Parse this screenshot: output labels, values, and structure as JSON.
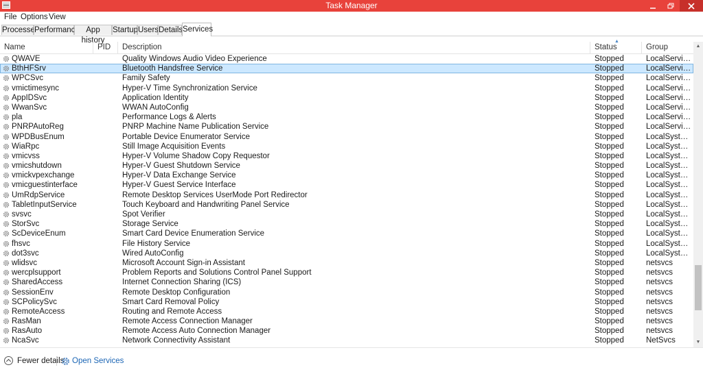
{
  "window": {
    "title": "Task Manager",
    "icon": "task-manager-icon",
    "controls": [
      "minimize-icon",
      "maximize-icon",
      "close-icon"
    ]
  },
  "menu": {
    "file": "File",
    "options": "Options",
    "view": "View"
  },
  "tabs": [
    "Processes",
    "Performance",
    "App history",
    "Startup",
    "Users",
    "Details",
    "Services"
  ],
  "active_tab": "Services",
  "columns": {
    "name": "Name",
    "pid": "PID",
    "description": "Description",
    "status": "Status",
    "group": "Group"
  },
  "sort": {
    "column": "Status",
    "direction": "ascending"
  },
  "services": [
    {
      "name": "QWAVE",
      "pid": "",
      "description": "Quality Windows Audio Video Experience",
      "status": "Stopped",
      "group": "LocalServiceA..."
    },
    {
      "name": "BthHFSrv",
      "pid": "",
      "description": "Bluetooth Handsfree Service",
      "status": "Stopped",
      "group": "LocalServiceA...",
      "selected": true
    },
    {
      "name": "WPCSvc",
      "pid": "",
      "description": "Family Safety",
      "status": "Stopped",
      "group": "LocalServiceN..."
    },
    {
      "name": "vmictimesync",
      "pid": "",
      "description": "Hyper-V Time Synchronization Service",
      "status": "Stopped",
      "group": "LocalServiceN..."
    },
    {
      "name": "AppIDSvc",
      "pid": "",
      "description": "Application Identity",
      "status": "Stopped",
      "group": "LocalServiceN..."
    },
    {
      "name": "WwanSvc",
      "pid": "",
      "description": "WWAN AutoConfig",
      "status": "Stopped",
      "group": "LocalServiceN..."
    },
    {
      "name": "pla",
      "pid": "",
      "description": "Performance Logs & Alerts",
      "status": "Stopped",
      "group": "LocalServiceN..."
    },
    {
      "name": "PNRPAutoReg",
      "pid": "",
      "description": "PNRP Machine Name Publication Service",
      "status": "Stopped",
      "group": "LocalServiceP..."
    },
    {
      "name": "WPDBusEnum",
      "pid": "",
      "description": "Portable Device Enumerator Service",
      "status": "Stopped",
      "group": "LocalSystemN..."
    },
    {
      "name": "WiaRpc",
      "pid": "",
      "description": "Still Image Acquisition Events",
      "status": "Stopped",
      "group": "LocalSystemN..."
    },
    {
      "name": "vmicvss",
      "pid": "",
      "description": "Hyper-V Volume Shadow Copy Requestor",
      "status": "Stopped",
      "group": "LocalSystemN..."
    },
    {
      "name": "vmicshutdown",
      "pid": "",
      "description": "Hyper-V Guest Shutdown Service",
      "status": "Stopped",
      "group": "LocalSystemN..."
    },
    {
      "name": "vmickvpexchange",
      "pid": "",
      "description": "Hyper-V Data Exchange Service",
      "status": "Stopped",
      "group": "LocalSystemN..."
    },
    {
      "name": "vmicguestinterface",
      "pid": "",
      "description": "Hyper-V Guest Service Interface",
      "status": "Stopped",
      "group": "LocalSystemN..."
    },
    {
      "name": "UmRdpService",
      "pid": "",
      "description": "Remote Desktop Services UserMode Port Redirector",
      "status": "Stopped",
      "group": "LocalSystemN..."
    },
    {
      "name": "TabletInputService",
      "pid": "",
      "description": "Touch Keyboard and Handwriting Panel Service",
      "status": "Stopped",
      "group": "LocalSystemN..."
    },
    {
      "name": "svsvc",
      "pid": "",
      "description": "Spot Verifier",
      "status": "Stopped",
      "group": "LocalSystemN..."
    },
    {
      "name": "StorSvc",
      "pid": "",
      "description": "Storage Service",
      "status": "Stopped",
      "group": "LocalSystemN..."
    },
    {
      "name": "ScDeviceEnum",
      "pid": "",
      "description": "Smart Card Device Enumeration Service",
      "status": "Stopped",
      "group": "LocalSystemN..."
    },
    {
      "name": "fhsvc",
      "pid": "",
      "description": "File History Service",
      "status": "Stopped",
      "group": "LocalSystemN..."
    },
    {
      "name": "dot3svc",
      "pid": "",
      "description": "Wired AutoConfig",
      "status": "Stopped",
      "group": "LocalSystemN..."
    },
    {
      "name": "wlidsvc",
      "pid": "",
      "description": "Microsoft Account Sign-in Assistant",
      "status": "Stopped",
      "group": "netsvcs"
    },
    {
      "name": "wercplsupport",
      "pid": "",
      "description": "Problem Reports and Solutions Control Panel Support",
      "status": "Stopped",
      "group": "netsvcs"
    },
    {
      "name": "SharedAccess",
      "pid": "",
      "description": "Internet Connection Sharing (ICS)",
      "status": "Stopped",
      "group": "netsvcs"
    },
    {
      "name": "SessionEnv",
      "pid": "",
      "description": "Remote Desktop Configuration",
      "status": "Stopped",
      "group": "netsvcs"
    },
    {
      "name": "SCPolicySvc",
      "pid": "",
      "description": "Smart Card Removal Policy",
      "status": "Stopped",
      "group": "netsvcs"
    },
    {
      "name": "RemoteAccess",
      "pid": "",
      "description": "Routing and Remote Access",
      "status": "Stopped",
      "group": "netsvcs"
    },
    {
      "name": "RasMan",
      "pid": "",
      "description": "Remote Access Connection Manager",
      "status": "Stopped",
      "group": "netsvcs"
    },
    {
      "name": "RasAuto",
      "pid": "",
      "description": "Remote Access Auto Connection Manager",
      "status": "Stopped",
      "group": "netsvcs"
    },
    {
      "name": "NcaSvc",
      "pid": "",
      "description": "Network Connectivity Assistant",
      "status": "Stopped",
      "group": "NetSvcs"
    }
  ],
  "footer": {
    "fewer_details": "Fewer details",
    "open_services": "Open Services"
  },
  "colors": {
    "titlebar": "#e8423b",
    "selection": "#cce8ff",
    "link": "#1c66b5"
  }
}
